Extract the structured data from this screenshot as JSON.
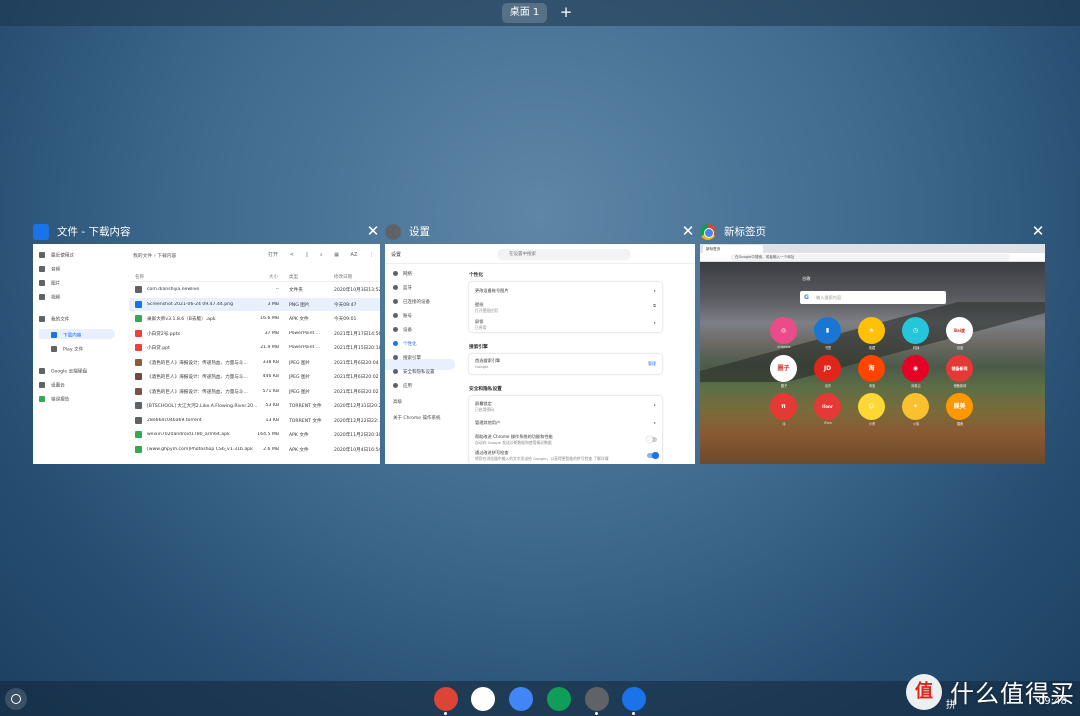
{
  "desk_bar": {
    "desk_label": "桌面 1",
    "add_label": "+"
  },
  "files": {
    "title": "文件 - 下载内容",
    "close": "✕",
    "sidebar": [
      {
        "label": "最近使用过"
      },
      {
        "label": "音频"
      },
      {
        "label": "图片"
      },
      {
        "label": "视频"
      },
      {
        "label": "我的文件"
      },
      {
        "label": "下载内容"
      },
      {
        "label": "Play 文件"
      },
      {
        "label": "Google 云端硬盘"
      },
      {
        "label": "设置云"
      },
      {
        "label": "错误报告"
      }
    ],
    "breadcrumb": "我的文件  ›  下载内容",
    "toolbar": [
      "打开",
      "⋖",
      "▯",
      "⌕",
      "▦",
      "AZ",
      "⋮"
    ],
    "columns": [
      "名称",
      "大小",
      "类型",
      "修改日期"
    ],
    "rows": [
      {
        "name": "com.dianshijia.newlive",
        "size": "--",
        "type": "文件夹",
        "date": "2020年10月3日13:52",
        "color": "#5f6368"
      },
      {
        "name": "Screenshot 2021-06-24 09.47.44.png",
        "size": "3 MB",
        "type": "PNG 图片",
        "date": "今天09:47",
        "color": "#1a73e8"
      },
      {
        "name": "录屏大师v3.1.8.6（B去版）.apk",
        "size": "16.6 MB",
        "type": "APK 文件",
        "date": "今天09:01",
        "color": "#34a853"
      },
      {
        "name": "小白贷2号.pptx",
        "size": "37 MB",
        "type": "PowerPoint ...",
        "date": "2021年1月17日14:56",
        "color": "#ea4335"
      },
      {
        "name": "小白贷.ppt",
        "size": "21.9 MB",
        "type": "PowerPoint ...",
        "date": "2021年1月15日20:18",
        "color": "#ea4335"
      },
      {
        "name": "《酒色的巨人》海报设计：传递热血、力量与斗...",
        "size": "338 KB",
        "type": "JPEG 图片",
        "date": "2021年1月6日20:04",
        "color": "#8d5a3b"
      },
      {
        "name": "《酒色的巨人》海报设计：传递热血、力量与斗...",
        "size": "446 KB",
        "type": "JPEG 图片",
        "date": "2021年1月6日20:02",
        "color": "#6d4c41"
      },
      {
        "name": "《酒色的巨人》海报设计：传递热血、力量与斗...",
        "size": "571 KB",
        "type": "JPEG 图片",
        "date": "2021年1月6日20:02",
        "color": "#795548"
      },
      {
        "name": "[BTSCHOOL] 大江大河2.Like.A.Flowing.River.20...",
        "size": "53 KB",
        "type": "TORRENT 文件",
        "date": "2020年12月31日20:24",
        "color": "#5f6368"
      },
      {
        "name": "28e664c046a69.torrent",
        "size": "13 KB",
        "type": "TORRENT 文件",
        "date": "2020年12月22日22:...",
        "color": "#5f6368"
      },
      {
        "name": "weixin7020android1780_arm64.apk",
        "size": "164.5 MB",
        "type": "APK 文件",
        "date": "2020年11月2日20:30",
        "color": "#34a853"
      },
      {
        "name": "[www.ghpym.com]Photoshop CS6_v1.31b.apk",
        "size": "2.6 MB",
        "type": "APK 文件",
        "date": "2020年10月4日16:54",
        "color": "#34a853"
      }
    ]
  },
  "settings": {
    "title": "设置",
    "close": "✕",
    "topbar_title": "设置",
    "search_placeholder": "在设置中搜索",
    "nav": [
      "网络",
      "蓝牙",
      "已连接的设备",
      "账号",
      "设备",
      "个性化",
      "搜索引擎",
      "安全和隐私设置",
      "应用",
      "高级",
      "关于 Chrome 操作系统"
    ],
    "sec1": "个性化",
    "card1": [
      {
        "text": "更改设备账号图片"
      },
      {
        "text": "壁纸",
        "sub": "打开壁纸应用"
      },
      {
        "text": "屏保",
        "sub": "已停用"
      }
    ],
    "sec2": "搜索引擎",
    "card2": {
      "text": "首选搜索引擎",
      "sub": "Google",
      "btn": "管理"
    },
    "sec3": "安全和隐私设置",
    "card3": [
      {
        "text": "屏幕锁定",
        "sub": "已启用密码"
      },
      {
        "text": "管理其他用户"
      },
      {
        "text": "帮助改进 Chrome 操作系统的功能和性能",
        "sub": "自动向 Google 发送诊断数据和使用情况数据"
      },
      {
        "text": "通过改进拼写检查",
        "sub": "将您在浏览器中输入的文字发送给 Google，以获得更智能的拼写检查  了解详情"
      }
    ]
  },
  "chrome": {
    "title": "新标签页",
    "close": "✕",
    "tab_label": "新标签页",
    "omnibox": "在Google中搜索，或者输入一个网址",
    "engine_label": "谷歌",
    "search_placeholder": "输入搜索内容",
    "tiles": [
      {
        "label": "dribbble",
        "glyph": "◎",
        "color": "#ea4c89"
      },
      {
        "label": "书签",
        "glyph": "▮",
        "color": "#1976d2"
      },
      {
        "label": "收藏",
        "glyph": "★",
        "color": "#ffc107"
      },
      {
        "label": "时钟",
        "glyph": "◷",
        "color": "#26c6da"
      },
      {
        "label": "百度",
        "glyph": "Bai度",
        "color": "#ffffff"
      },
      {
        "label": "圈子",
        "glyph": "圈子",
        "color": "#ffffff"
      },
      {
        "label": "京东",
        "glyph": "JD",
        "color": "#e1251b"
      },
      {
        "label": "淘宝",
        "glyph": "淘",
        "color": "#ff4400"
      },
      {
        "label": "网易云",
        "glyph": "◉",
        "color": "#e60026"
      },
      {
        "label": "储备新闻",
        "glyph": "储备新闻",
        "color": "#e53935"
      },
      {
        "label": "派",
        "glyph": "π",
        "color": "#e53935"
      },
      {
        "label": "iFonr",
        "glyph": "ifonr",
        "color": "#e53935"
      },
      {
        "label": "小黄",
        "glyph": "☺",
        "color": "#fdd835"
      },
      {
        "label": "火焰",
        "glyph": "✦",
        "color": "#fbc02d"
      },
      {
        "label": "展美",
        "glyph": "展美",
        "color": "#ff9800"
      }
    ]
  },
  "shelf": {
    "apps": [
      {
        "name": "chrome-app",
        "color": "#db4437"
      },
      {
        "name": "play-store-app",
        "color": "#ffffff"
      },
      {
        "name": "messages-app",
        "color": "#4285f4"
      },
      {
        "name": "linux-app",
        "color": "#0f9d58"
      },
      {
        "name": "settings-app",
        "color": "#5f6368"
      },
      {
        "name": "files-app",
        "color": "#1a73e8"
      }
    ],
    "tray_ime": "拼",
    "tray_time": "09:48"
  },
  "watermark": {
    "logo": "值",
    "text": "什么值得买"
  }
}
